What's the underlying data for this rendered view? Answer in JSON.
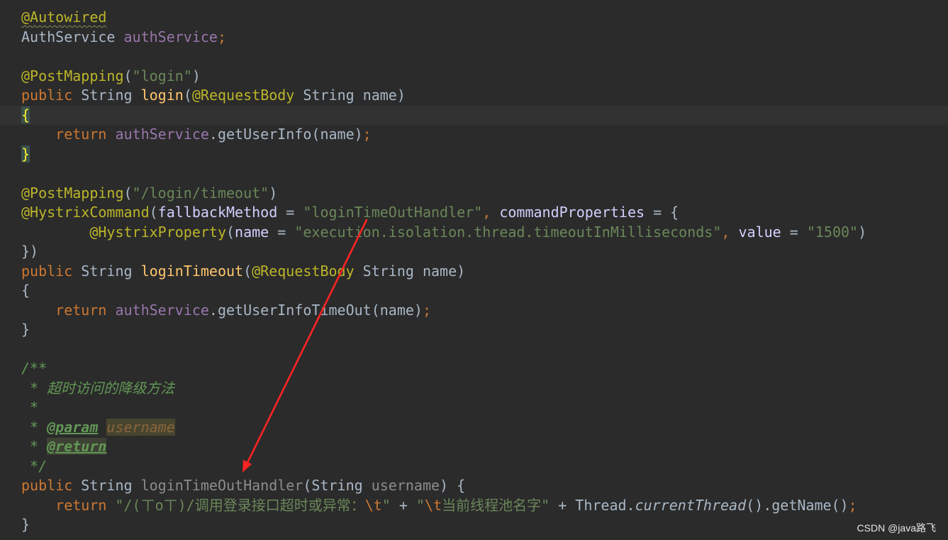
{
  "theme": {
    "background": "#2b2b2b",
    "caret_row": "#323232",
    "tokens": {
      "p": {
        "color": "#a9b7c6"
      },
      "kw": {
        "color": "#cc7832"
      },
      "ann": {
        "color": "#bbb529"
      },
      "annw": {
        "color": "#bbb529",
        "wavy": "#8c8a5c"
      },
      "str": {
        "color": "#6a8759"
      },
      "esc": {
        "color": "#cc7832"
      },
      "fn": {
        "color": "#ffc66d"
      },
      "fld": {
        "color": "#9876aa"
      },
      "arg": {
        "color": "#d0d0ff"
      },
      "sep": {
        "color": "#cc7832"
      },
      "unused": {
        "color": "#8c8c8c"
      },
      "static": {
        "color": "#a9b7c6",
        "italic": true
      },
      "doc": {
        "color": "#629755",
        "italic": true
      },
      "doctag": {
        "color": "#629755",
        "italic": true,
        "bold": true,
        "underline": true
      },
      "doctagbg": {
        "color": "#629755",
        "italic": true,
        "bold": true,
        "underline": true,
        "bg": "#3d4234"
      },
      "docparam": {
        "color": "#8a653b",
        "italic": true,
        "bg": "#48452f"
      },
      "brace": {
        "color": "#ffef28",
        "bg": "#3b514d"
      }
    }
  },
  "editor": {
    "caret_line": 6,
    "lines": [
      [
        {
          "annw": "@Autowired"
        }
      ],
      [
        {
          "p": "AuthService "
        },
        {
          "fld": "authService"
        },
        {
          "sep": ";"
        }
      ],
      [],
      [
        {
          "ann": "@PostMapping"
        },
        {
          "p": "("
        },
        {
          "str": "\"login\""
        },
        {
          "p": ")"
        }
      ],
      [
        {
          "kw": "public "
        },
        {
          "p": "String "
        },
        {
          "fn": "login"
        },
        {
          "p": "("
        },
        {
          "ann": "@RequestBody"
        },
        {
          "p": " String name)"
        }
      ],
      [
        {
          "brace": "{"
        }
      ],
      [
        {
          "p": "    "
        },
        {
          "kw": "return "
        },
        {
          "fld": "authService"
        },
        {
          "p": ".getUserInfo(name)"
        },
        {
          "sep": ";"
        }
      ],
      [
        {
          "brace": "}"
        }
      ],
      [],
      [
        {
          "ann": "@PostMapping"
        },
        {
          "p": "("
        },
        {
          "str": "\"/login/timeout\""
        },
        {
          "p": ")"
        }
      ],
      [
        {
          "ann": "@HystrixCommand"
        },
        {
          "p": "("
        },
        {
          "arg": "fallbackMethod"
        },
        {
          "p": " = "
        },
        {
          "str": "\"loginTimeOutHandler\""
        },
        {
          "sep": ", "
        },
        {
          "arg": "commandProperties"
        },
        {
          "p": " = {"
        }
      ],
      [
        {
          "p": "        "
        },
        {
          "ann": "@HystrixProperty"
        },
        {
          "p": "("
        },
        {
          "arg": "name"
        },
        {
          "p": " = "
        },
        {
          "str": "\"execution.isolation.thread.timeoutInMilliseconds\""
        },
        {
          "sep": ", "
        },
        {
          "arg": "value"
        },
        {
          "p": " = "
        },
        {
          "str": "\"1500\""
        },
        {
          "p": ")"
        }
      ],
      [
        {
          "p": "})"
        }
      ],
      [
        {
          "kw": "public "
        },
        {
          "p": "String "
        },
        {
          "fn": "loginTimeout"
        },
        {
          "p": "("
        },
        {
          "ann": "@RequestBody"
        },
        {
          "p": " String name)"
        }
      ],
      [
        {
          "p": "{"
        }
      ],
      [
        {
          "p": "    "
        },
        {
          "kw": "return "
        },
        {
          "fld": "authService"
        },
        {
          "p": ".getUserInfoTimeOut(name)"
        },
        {
          "sep": ";"
        }
      ],
      [
        {
          "p": "}"
        }
      ],
      [],
      [
        {
          "doc": "/**"
        }
      ],
      [
        {
          "doc": " * 超时访问的降级方法"
        }
      ],
      [
        {
          "doc": " *"
        }
      ],
      [
        {
          "doc": " * "
        },
        {
          "doctag": "@param"
        },
        {
          "doc": " "
        },
        {
          "docparam": "username"
        }
      ],
      [
        {
          "doc": " * "
        },
        {
          "doctagbg": "@return"
        }
      ],
      [
        {
          "doc": " */"
        }
      ],
      [
        {
          "kw": "public "
        },
        {
          "p": "String "
        },
        {
          "unused": "loginTimeOutHandler"
        },
        {
          "p": "(String "
        },
        {
          "unused": "username"
        },
        {
          "p": ") {"
        }
      ],
      [
        {
          "p": "    "
        },
        {
          "kw": "return "
        },
        {
          "str": "\"/(ㄒoㄒ)/调用登录接口超时或异常："
        },
        {
          "esc": "\\t"
        },
        {
          "str": "\""
        },
        {
          "p": " + "
        },
        {
          "str": "\""
        },
        {
          "esc": "\\t"
        },
        {
          "str": "当前线程池名字\""
        },
        {
          "p": " + Thread."
        },
        {
          "static": "currentThread"
        },
        {
          "p": "().getName()"
        },
        {
          "sep": ";"
        }
      ],
      [
        {
          "p": "}"
        }
      ]
    ]
  },
  "watermark": {
    "text": "CSDN @java路飞",
    "color": "#e6e6e6"
  },
  "annotation": {
    "arrow_color": "#ff2323"
  }
}
